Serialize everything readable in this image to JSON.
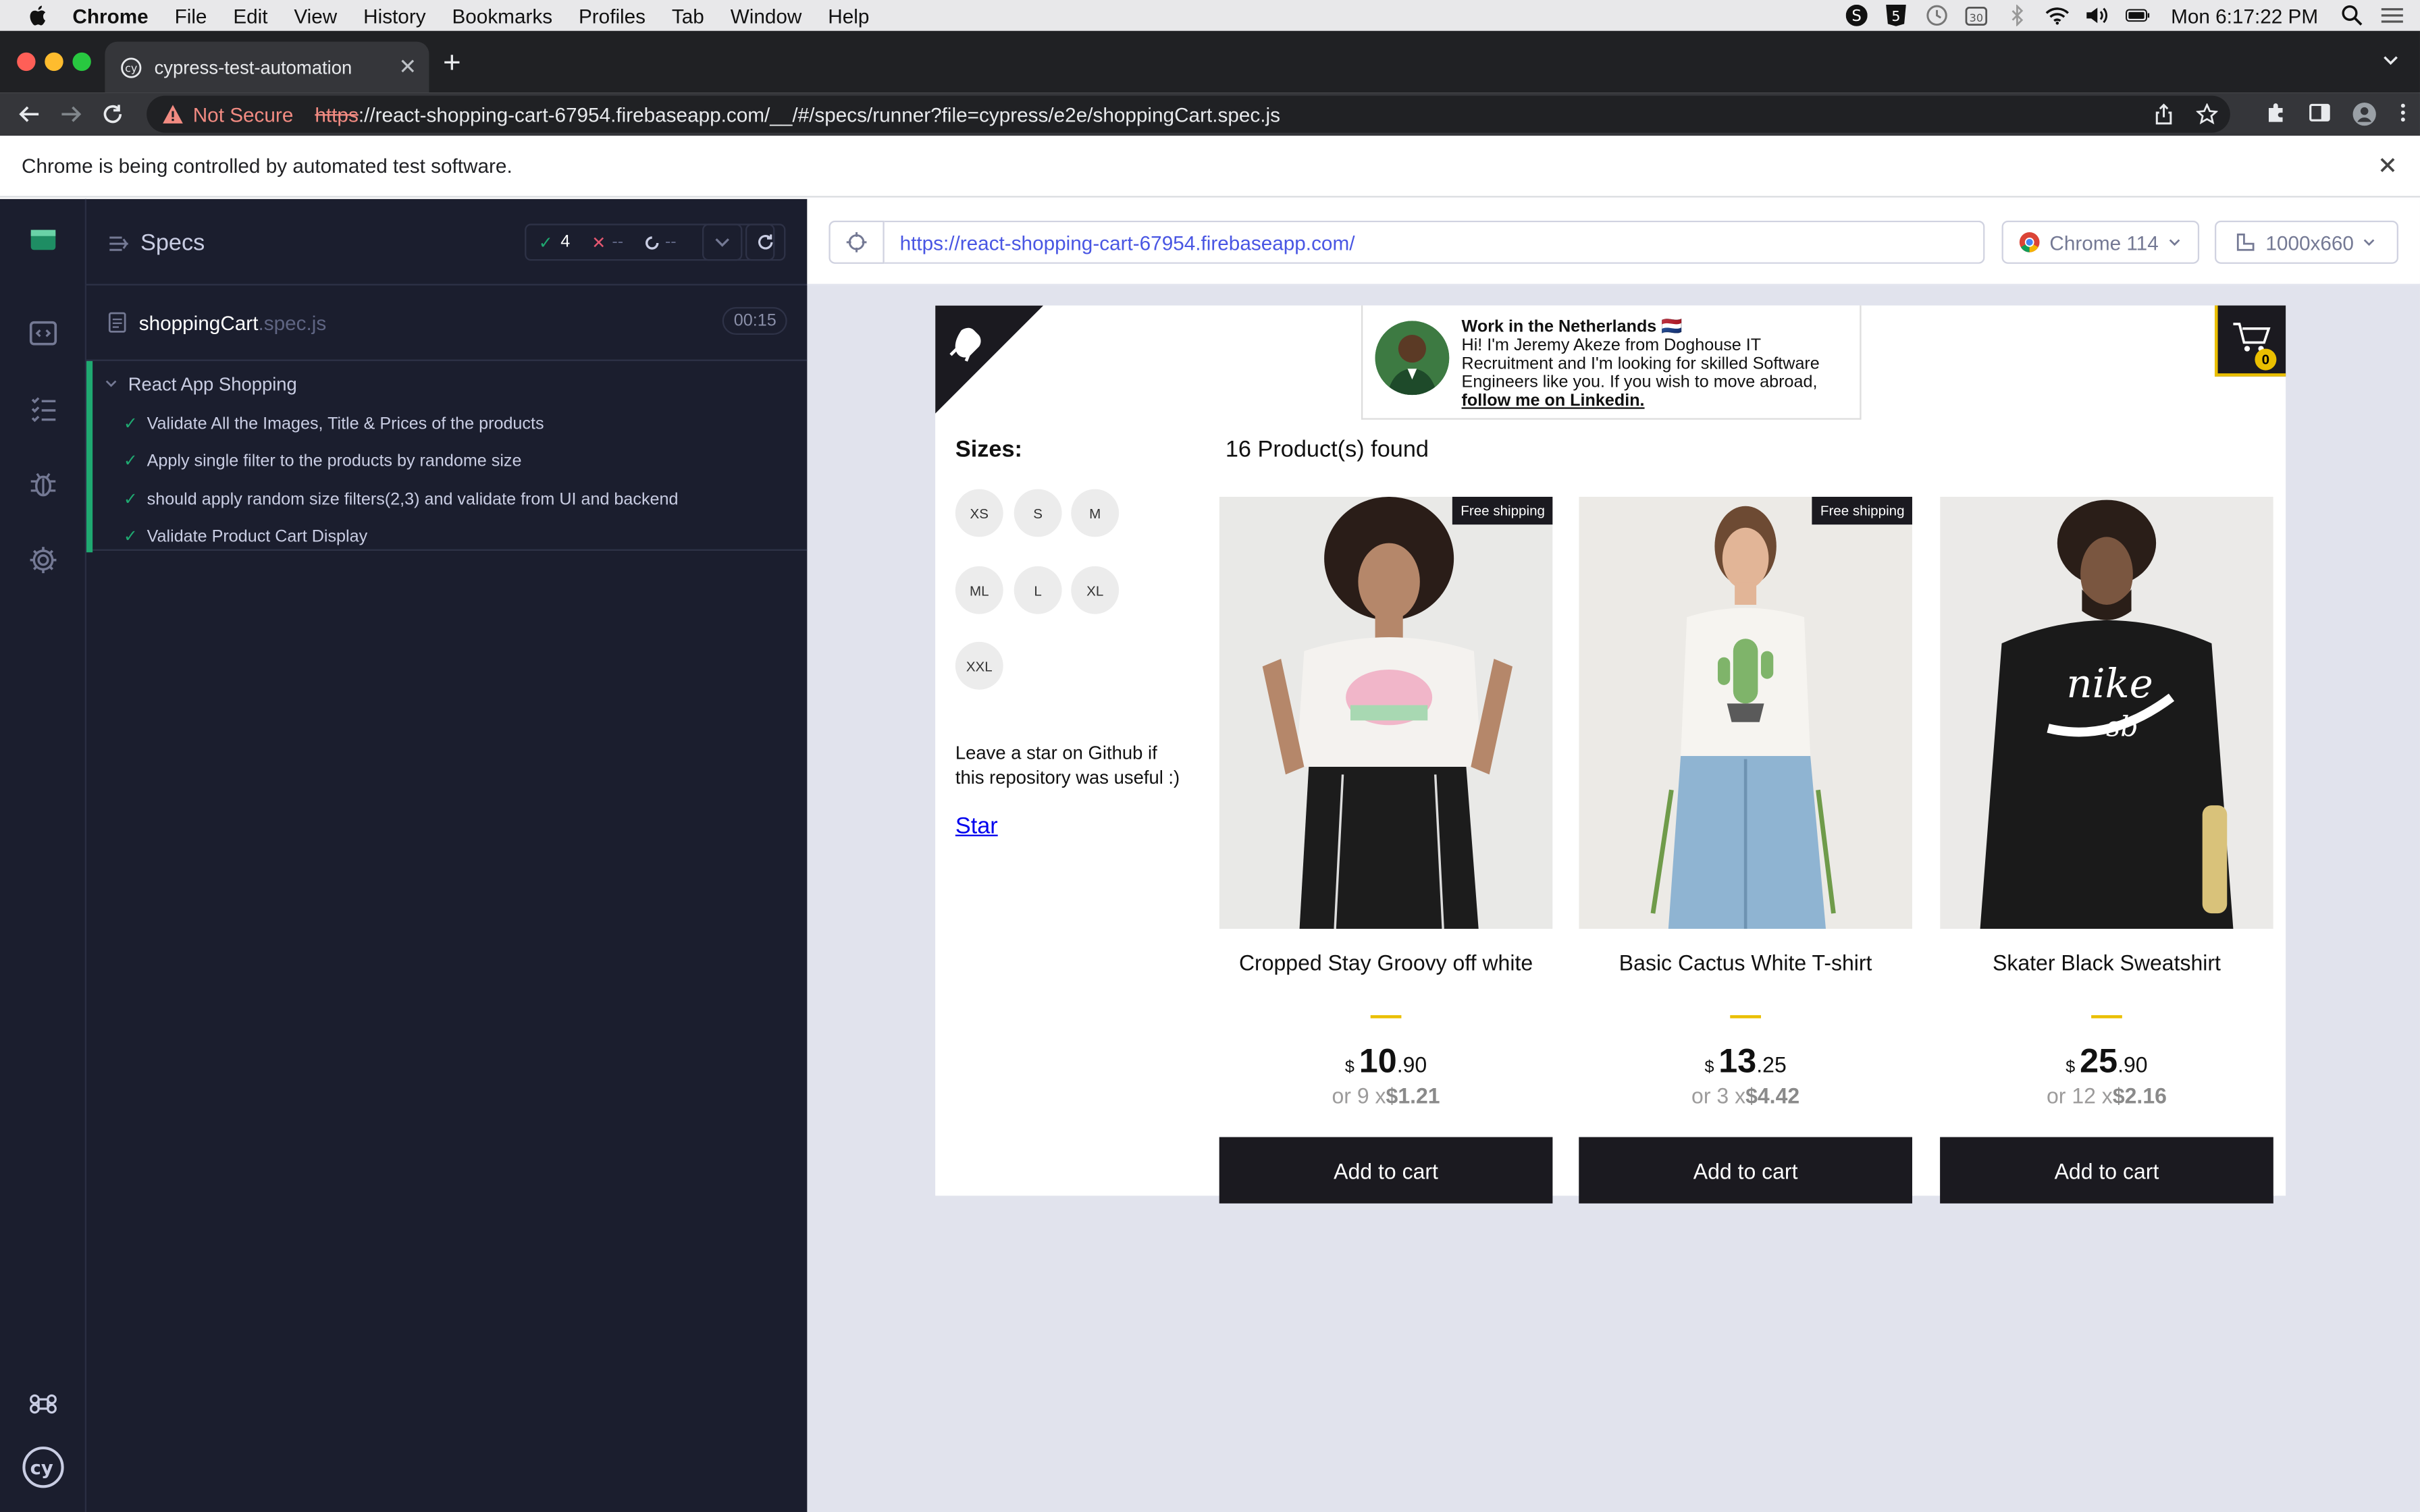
{
  "menubar": {
    "app": "Chrome",
    "items": [
      "File",
      "Edit",
      "View",
      "History",
      "Bookmarks",
      "Profiles",
      "Tab",
      "Window",
      "Help"
    ],
    "clock": "Mon 6:17:22 PM"
  },
  "tab": {
    "title": "cypress-test-automation"
  },
  "omnibox": {
    "security": "Not Secure",
    "scheme": "https",
    "rest": "://react-shopping-cart-67954.firebaseapp.com/__/#/specs/runner?file=cypress/e2e/shoppingCart.spec.js"
  },
  "infobar": {
    "text": "Chrome is being controlled by automated test software."
  },
  "cypress": {
    "specs_label": "Specs",
    "passed": "4",
    "failed": "--",
    "pending": "--",
    "spec_name": "shoppingCart",
    "spec_ext": ".spec.js",
    "duration": "00:15",
    "suite": "React App Shopping",
    "tests": [
      "Validate All the Images, Title & Prices of the products",
      "Apply single filter to the products by randome size",
      "should apply random size filters(2,3) and validate from UI and backend",
      "Validate Product Cart Display"
    ]
  },
  "aut": {
    "url": "https://react-shopping-cart-67954.firebaseapp.com/",
    "browser": "Chrome 114",
    "viewport": "1000x660"
  },
  "shop": {
    "promo_title": "Work in the Netherlands 🇳🇱",
    "promo_body": "Hi! I'm Jeremy Akeze from Doghouse IT Recruitment and I'm looking for skilled Software Engineers like you. If you wish to move abroad,",
    "promo_link": "follow me on Linkedin.",
    "cart_count": "0",
    "sizes_title": "Sizes:",
    "sizes": [
      "XS",
      "S",
      "M",
      "ML",
      "L",
      "XL",
      "XXL"
    ],
    "github_text": "Leave a star on Github if this repository was useful :)",
    "star_link": "Star",
    "found": "16 Product(s) found",
    "products": [
      {
        "title": "Cropped Stay Groovy off white",
        "currency": "$",
        "price_int": "10",
        "price_dec": ".90",
        "inst_prefix": "or 9 x",
        "inst_value": "$1.21",
        "free_shipping": "Free shipping",
        "button": "Add to cart"
      },
      {
        "title": "Basic Cactus White T-shirt",
        "currency": "$",
        "price_int": "13",
        "price_dec": ".25",
        "inst_prefix": "or 3 x",
        "inst_value": "$4.42",
        "free_shipping": "Free shipping",
        "button": "Add to cart"
      },
      {
        "title": "Skater Black Sweatshirt",
        "currency": "$",
        "price_int": "25",
        "price_dec": ".90",
        "inst_prefix": "or 12 x",
        "inst_value": "$2.16",
        "free_shipping": "",
        "button": "Add to cart"
      }
    ]
  }
}
